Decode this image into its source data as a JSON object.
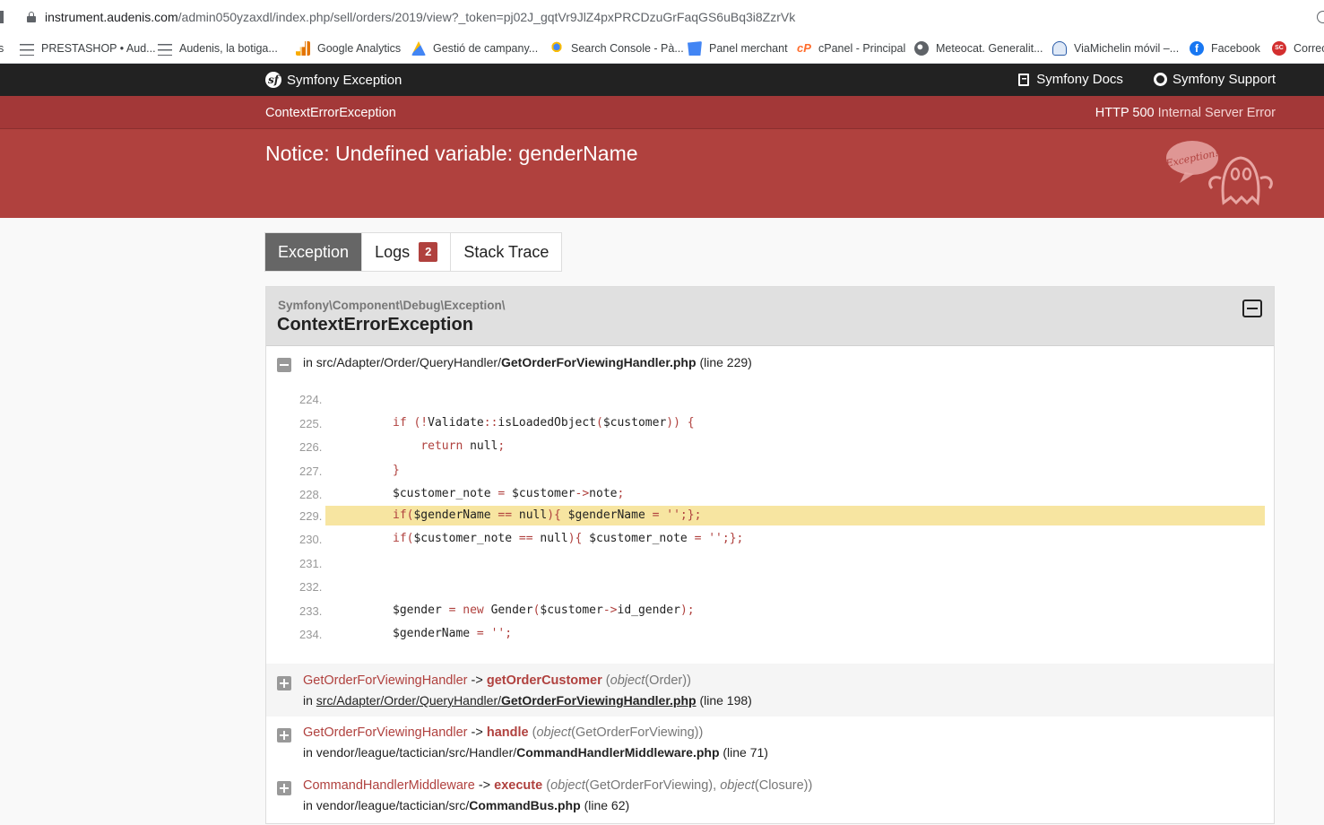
{
  "browser": {
    "url_host": "instrument.audenis.com",
    "url_path": "/admin050yzaxdl/index.php/sell/orders/2019/view?_token=pj02J_gqtVr9JlZ4pxPRCDzuGrFaqGS6uBq3i8ZzrVk",
    "bookmarks": [
      {
        "label": "s",
        "icon": "none"
      },
      {
        "label": "PRESTASHOP • Aud...",
        "icon": "lines-icon"
      },
      {
        "label": "Audenis, la botiga...",
        "icon": "lines-icon"
      },
      {
        "label": "Google Analytics",
        "icon": "analytics-icon"
      },
      {
        "label": "Gestió de campany...",
        "icon": "google-ads-icon"
      },
      {
        "label": "Search Console - Pà...",
        "icon": "search-console-icon"
      },
      {
        "label": "Panel merchant",
        "icon": "merchant-icon"
      },
      {
        "label": "cPanel - Principal",
        "icon": "cpanel-icon"
      },
      {
        "label": "Meteocat. Generalit...",
        "icon": "globe-icon"
      },
      {
        "label": "ViaMichelin móvil –...",
        "icon": "michelin-icon"
      },
      {
        "label": "Facebook",
        "icon": "facebook-icon"
      },
      {
        "label": "Correc",
        "icon": "sc-icon"
      }
    ]
  },
  "symfony": {
    "brand": "Symfony Exception",
    "docs_link": "Symfony Docs",
    "support_link": "Symfony Support",
    "exception_class_short": "ContextErrorException",
    "http_code": "HTTP 500",
    "http_text": "Internal Server Error",
    "message": "Notice: Undefined variable: genderName",
    "ghost_label": "Exception!"
  },
  "tabs": [
    {
      "label": "Exception",
      "active": true
    },
    {
      "label": "Logs",
      "badge": "2"
    },
    {
      "label": "Stack Trace"
    }
  ],
  "exception": {
    "namespace": "Symfony\\Component\\Debug\\Exception\\",
    "class": "ContextErrorException",
    "location": {
      "prefix": "in src/Adapter/Order/QueryHandler/",
      "file": "GetOrderForViewingHandler.php",
      "line": "(line 229)"
    },
    "code_lines": [
      {
        "num": "224.",
        "code": ""
      },
      {
        "num": "225.",
        "code": "if (!Validate::isLoadedObject($customer)) {"
      },
      {
        "num": "226.",
        "code": "    return null;"
      },
      {
        "num": "227.",
        "code": "}"
      },
      {
        "num": "228.",
        "code": "$customer_note = $customer->note;"
      },
      {
        "num": "229.",
        "code": "if($genderName == null){ $genderName = '';};",
        "highlight": true
      },
      {
        "num": "230.",
        "code": "if($customer_note == null){ $customer_note = '';};"
      },
      {
        "num": "231.",
        "code": ""
      },
      {
        "num": "232.",
        "code": ""
      },
      {
        "num": "233.",
        "code": "$gender = new Gender($customer->id_gender);"
      },
      {
        "num": "234.",
        "code": "$genderName = '';"
      }
    ],
    "trace": [
      {
        "class": "GetOrderForViewingHandler",
        "arrow": "->",
        "fn": "getOrderCustomer",
        "args_open": "(",
        "arg1_type": "object",
        "arg1": "(Order)",
        "args_rest": "",
        "args_close": ")",
        "file_prefix": "in ",
        "file_dir": "src/Adapter/Order/QueryHandler/",
        "file_name": "GetOrderForViewingHandler.php",
        "file_line": "(line 198)"
      },
      {
        "class": "GetOrderForViewingHandler",
        "arrow": "->",
        "fn": "handle",
        "args_open": "(",
        "arg1_type": "object",
        "arg1": "(GetOrderForViewing)",
        "args_rest": "",
        "args_close": ")",
        "file_prefix": "in vendor/league/tactician/src/Handler/",
        "file_dir": "",
        "file_name": "CommandHandlerMiddleware.php",
        "file_line": "(line 71)"
      },
      {
        "class": "CommandHandlerMiddleware",
        "arrow": "->",
        "fn": "execute",
        "args_open": "(",
        "arg1_type": "object",
        "arg1": "(GetOrderForViewing),",
        "arg2_type": "object",
        "arg2": "(Closure)",
        "args_close": ")",
        "file_prefix": "in vendor/league/tactician/src/",
        "file_dir": "",
        "file_name": "CommandBus.php",
        "file_line": "(line 62)"
      }
    ]
  },
  "colors": {
    "header_dark": "#222222",
    "status_bar": "#a33838",
    "message_bar": "#b0413e",
    "highlight": "#f7e5a1"
  }
}
